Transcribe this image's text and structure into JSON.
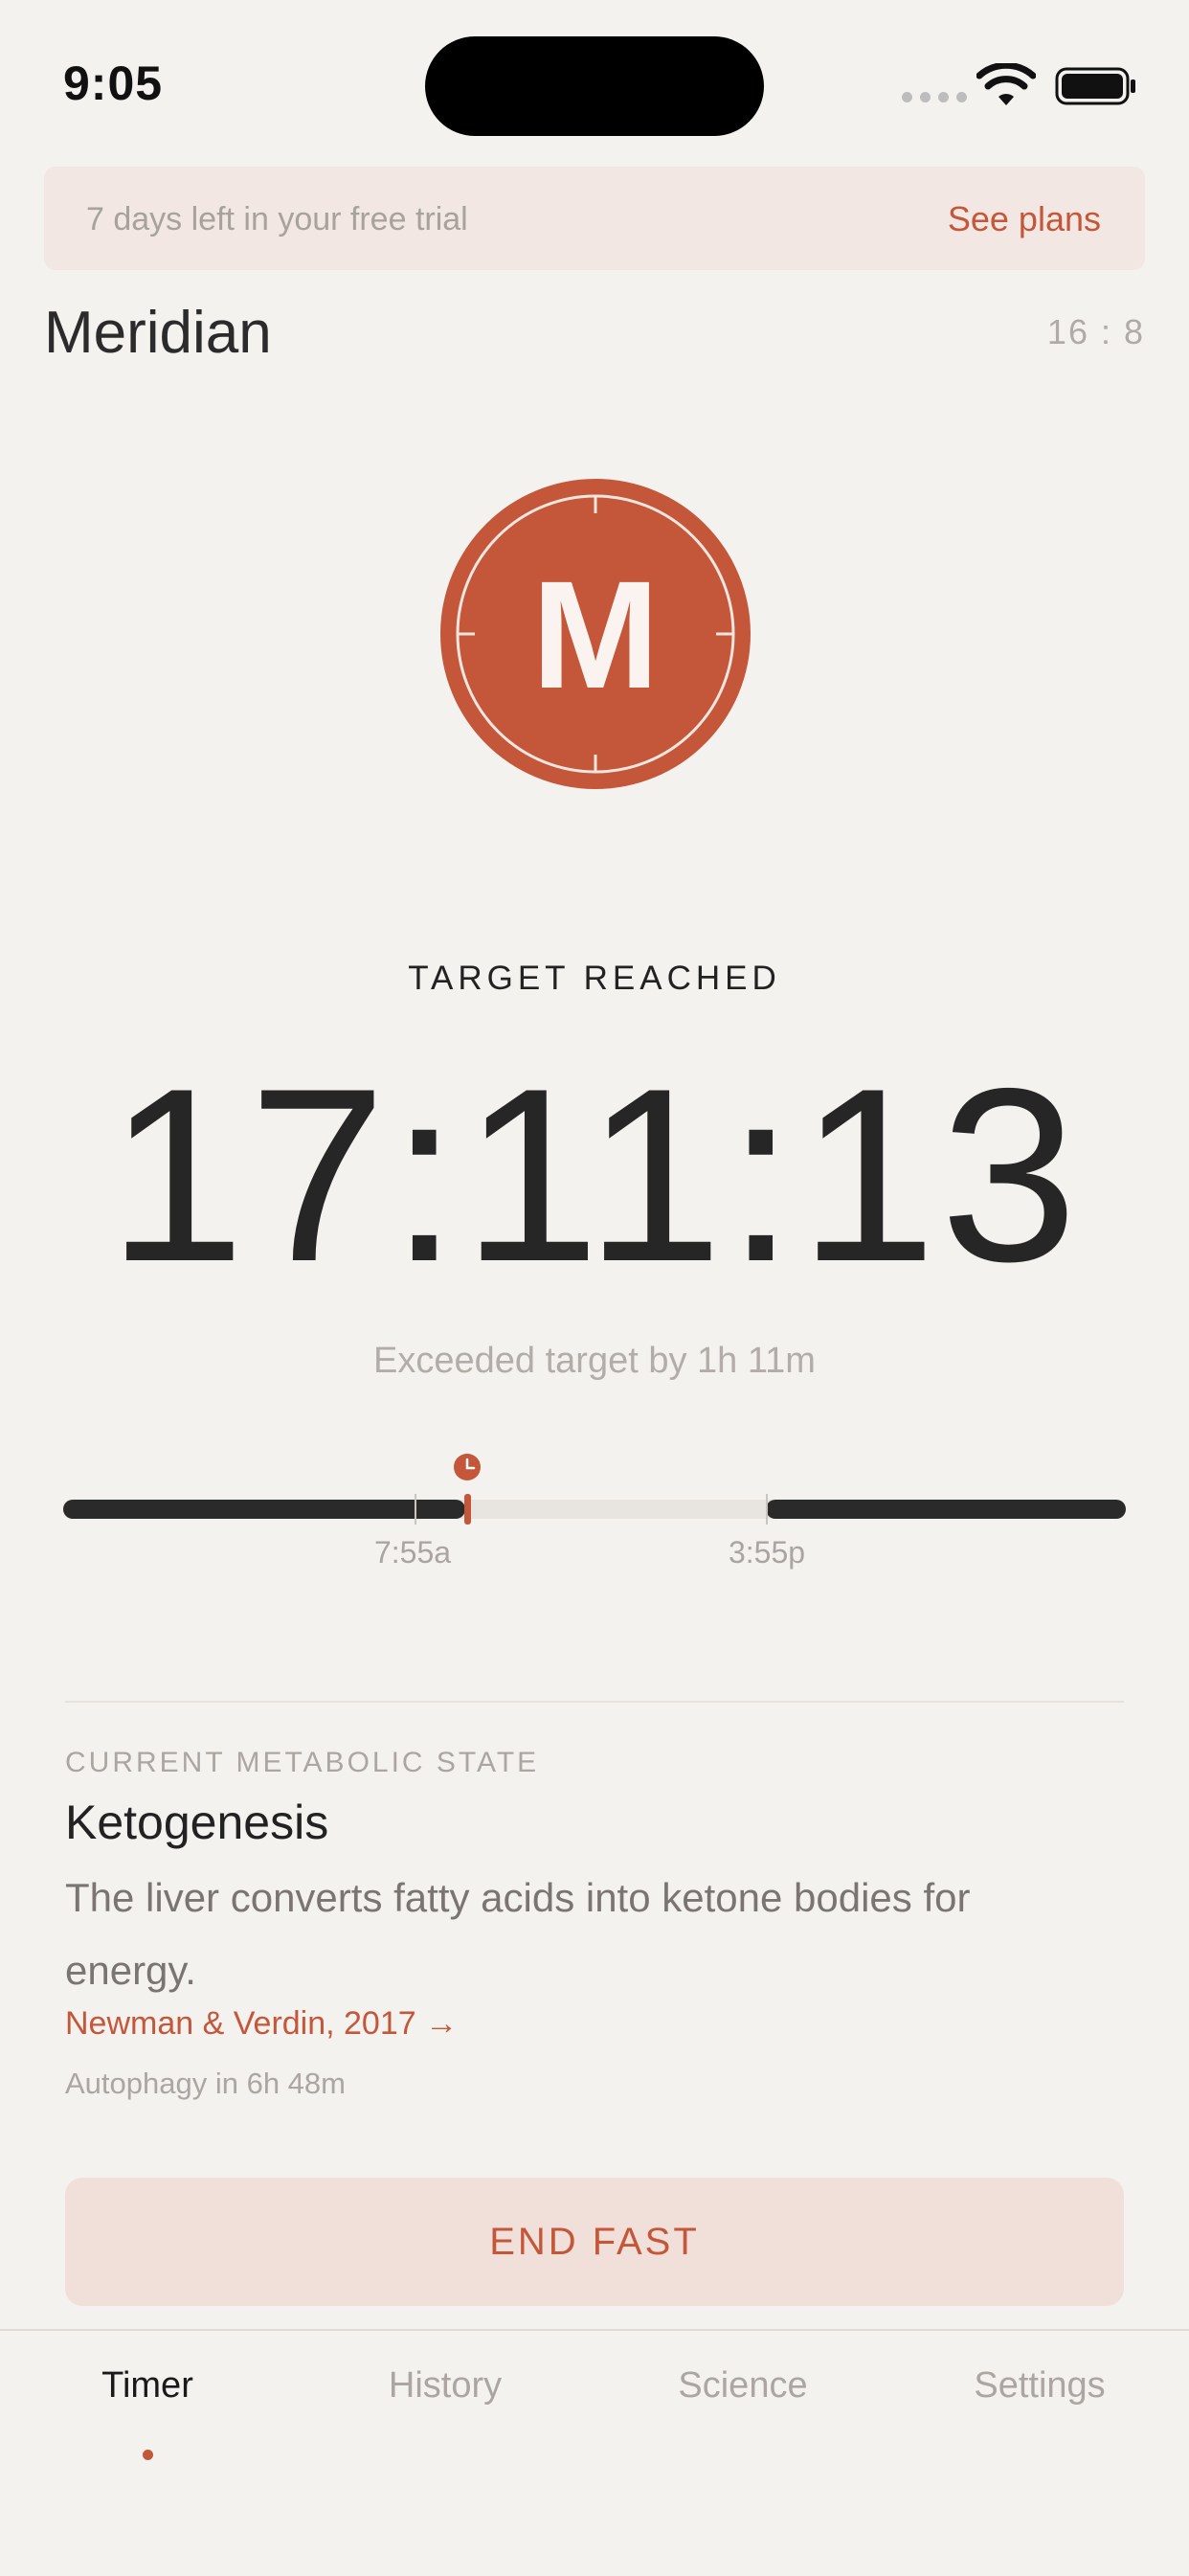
{
  "status_bar": {
    "time": "9:05"
  },
  "trial_banner": {
    "text": "7 days left in your free trial",
    "link": "See plans"
  },
  "header": {
    "title": "Meridian",
    "ratio": "16 : 8"
  },
  "logo": {
    "letter": "M"
  },
  "timer": {
    "state": "TARGET REACHED",
    "elapsed": "17:11:13",
    "subtitle": "Exceeded target by 1h 11m"
  },
  "timeline": {
    "start_label": "7:55a",
    "end_label": "3:55p"
  },
  "metabolic": {
    "label": "CURRENT METABOLIC STATE",
    "name": "Ketogenesis",
    "description": "The liver converts fatty acids into ketone bodies for energy.",
    "citation": "Newman & Verdin, 2017 →",
    "next": "Autophagy in 6h 48m"
  },
  "actions": {
    "end_fast": "END FAST"
  },
  "tabs": [
    {
      "label": "Timer",
      "active": true
    },
    {
      "label": "History",
      "active": false
    },
    {
      "label": "Science",
      "active": false
    },
    {
      "label": "Settings",
      "active": false
    }
  ],
  "colors": {
    "accent": "#c4573a",
    "background": "#f4f2ef",
    "dark": "#262626"
  }
}
